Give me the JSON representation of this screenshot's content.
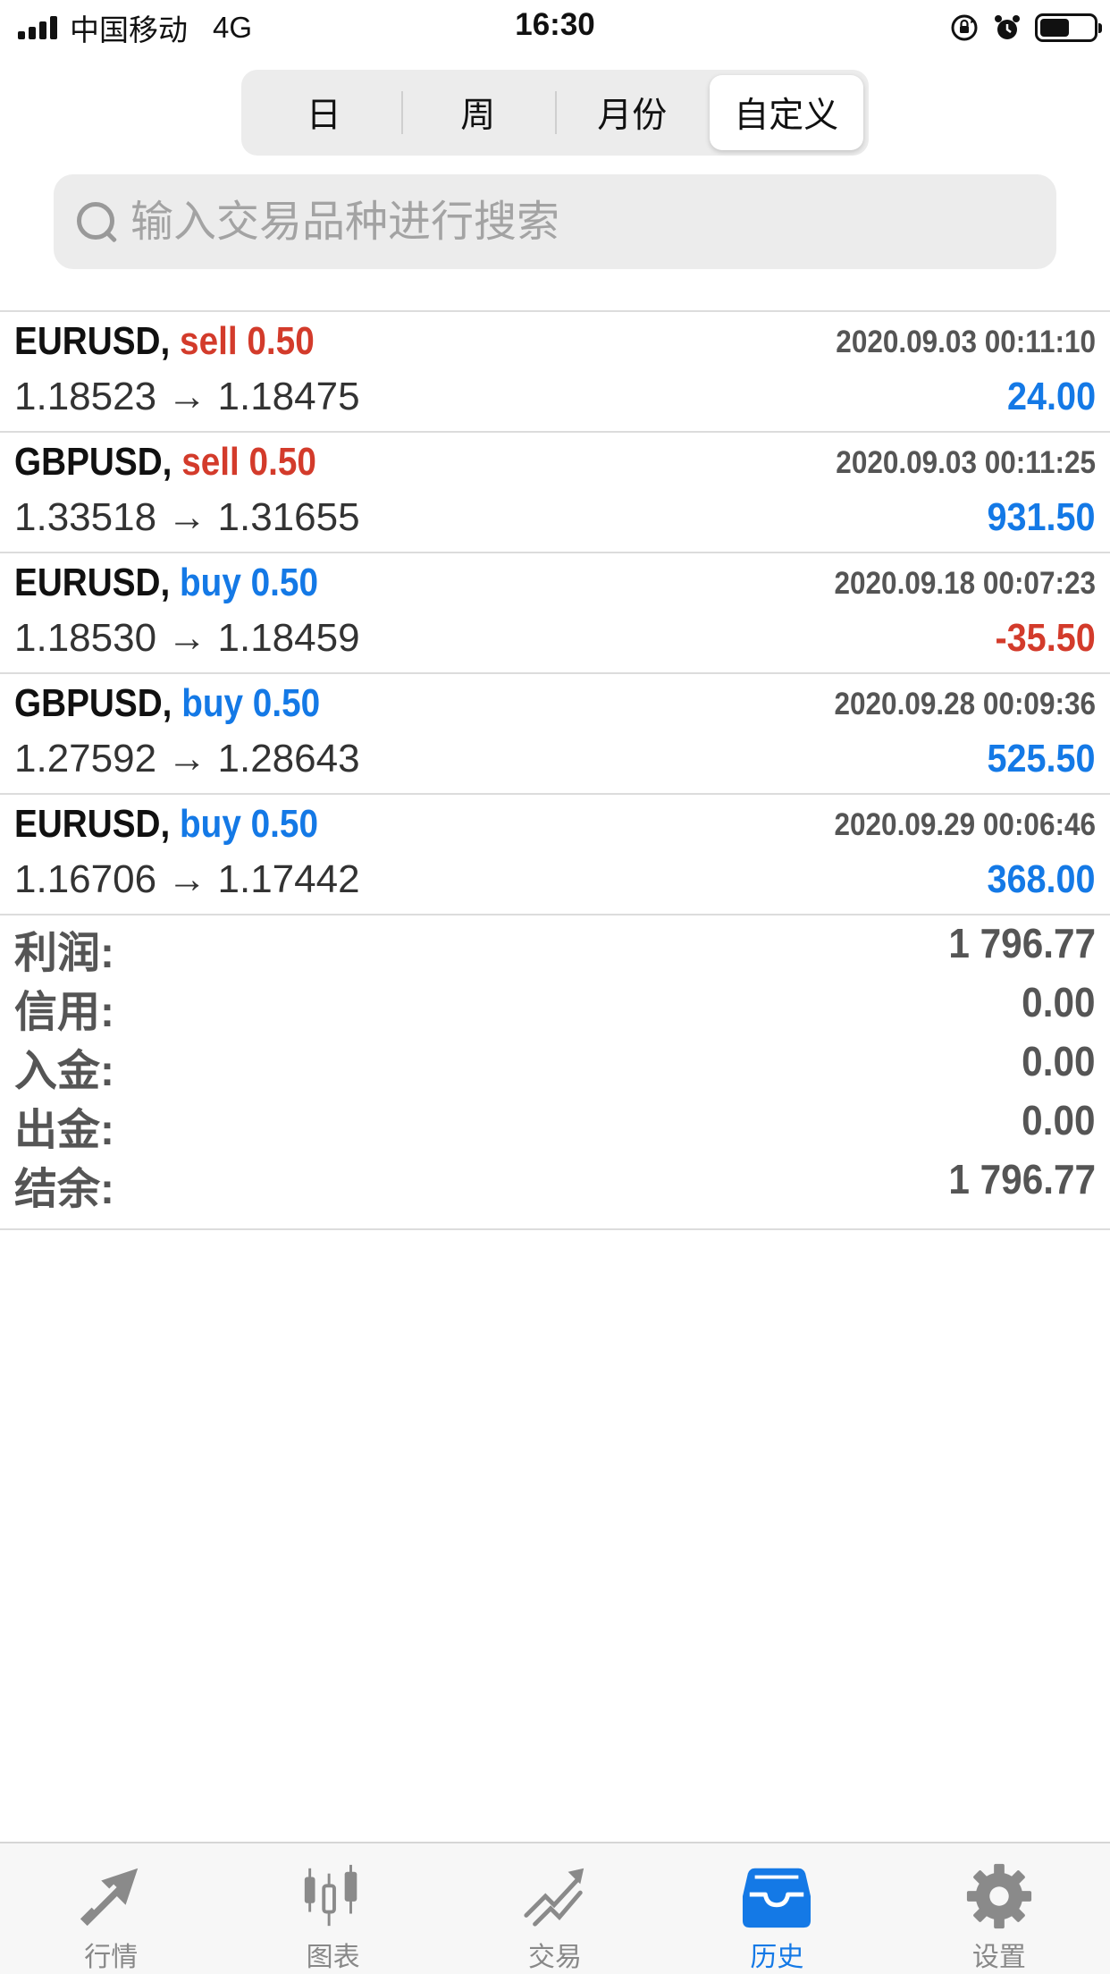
{
  "status_bar": {
    "carrier": "中国移动",
    "network": "4G",
    "time": "16:30"
  },
  "segments": [
    {
      "label": "日",
      "active": false
    },
    {
      "label": "周",
      "active": false
    },
    {
      "label": "月份",
      "active": false
    },
    {
      "label": "自定义",
      "active": true
    }
  ],
  "search": {
    "placeholder": "输入交易品种进行搜索"
  },
  "trades": [
    {
      "symbol": "EURUSD,",
      "side": "sell 0.50",
      "side_type": "sell",
      "time": "2020.09.03 00:11:10",
      "prices": "1.18523 → 1.18475",
      "profit": "24.00"
    },
    {
      "symbol": "GBPUSD,",
      "side": "sell 0.50",
      "side_type": "sell",
      "time": "2020.09.03 00:11:25",
      "prices": "1.33518 → 1.31655",
      "profit": "931.50"
    },
    {
      "symbol": "EURUSD,",
      "side": "buy 0.50",
      "side_type": "buy",
      "time": "2020.09.18 00:07:23",
      "prices": "1.18530 → 1.18459",
      "profit": "-35.50"
    },
    {
      "symbol": "GBPUSD,",
      "side": "buy 0.50",
      "side_type": "buy",
      "time": "2020.09.28 00:09:36",
      "prices": "1.27592 → 1.28643",
      "profit": "525.50"
    },
    {
      "symbol": "EURUSD,",
      "side": "buy 0.50",
      "side_type": "buy",
      "time": "2020.09.29 00:06:46",
      "prices": "1.16706 → 1.17442",
      "profit": "368.00"
    }
  ],
  "summary": [
    {
      "label": "利润:",
      "value": "1 796.77"
    },
    {
      "label": "信用:",
      "value": "0.00"
    },
    {
      "label": "入金:",
      "value": "0.00"
    },
    {
      "label": "出金:",
      "value": "0.00"
    },
    {
      "label": "结余:",
      "value": "1 796.77"
    }
  ],
  "tabs": [
    {
      "label": "行情",
      "icon": "quotes-arrows-icon",
      "active": false
    },
    {
      "label": "图表",
      "icon": "candlestick-chart-icon",
      "active": false
    },
    {
      "label": "交易",
      "icon": "trade-trend-icon",
      "active": false
    },
    {
      "label": "历史",
      "icon": "history-inbox-icon",
      "active": true
    },
    {
      "label": "设置",
      "icon": "gear-icon",
      "active": false
    }
  ],
  "colors": {
    "accent": "#1479e6",
    "sell": "#d33b2b",
    "loss": "#d33b2b",
    "profit": "#1479e6",
    "tab_inactive": "#888888"
  }
}
